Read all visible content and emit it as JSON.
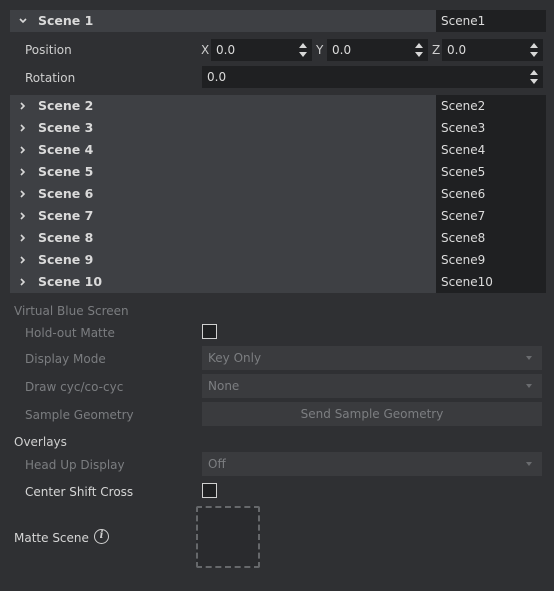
{
  "scene1": {
    "title": "Scene 1",
    "name_value": "Scene1",
    "position_label": "Position",
    "rotation_label": "Rotation",
    "axis_x": "X",
    "axis_y": "Y",
    "axis_z": "Z",
    "pos_x": "0.0",
    "pos_y": "0.0",
    "pos_z": "0.0",
    "rotation_value": "0.0"
  },
  "scenes": [
    {
      "title": "Scene 2",
      "name": "Scene2"
    },
    {
      "title": "Scene 3",
      "name": "Scene3"
    },
    {
      "title": "Scene 4",
      "name": "Scene4"
    },
    {
      "title": "Scene 5",
      "name": "Scene5"
    },
    {
      "title": "Scene 6",
      "name": "Scene6"
    },
    {
      "title": "Scene 7",
      "name": "Scene7"
    },
    {
      "title": "Scene 8",
      "name": "Scene8"
    },
    {
      "title": "Scene 9",
      "name": "Scene9"
    },
    {
      "title": "Scene 10",
      "name": "Scene10"
    }
  ],
  "virtual_blue_screen": {
    "heading": "Virtual Blue Screen",
    "holdout_label": "Hold-out Matte",
    "display_mode_label": "Display Mode",
    "display_mode_value": "Key Only",
    "draw_cyc_label": "Draw cyc/co-cyc",
    "draw_cyc_value": "None",
    "sample_geometry_label": "Sample Geometry",
    "sample_geometry_button": "Send Sample Geometry"
  },
  "overlays": {
    "heading": "Overlays",
    "hud_label": "Head Up Display",
    "hud_value": "Off",
    "center_shift_label": "Center Shift Cross"
  },
  "matte_scene": {
    "label": "Matte Scene",
    "info_glyph": "i"
  },
  "icons": {
    "expanded": "chevron-down-icon",
    "collapsed": "chevron-right-icon",
    "info": "info-icon"
  },
  "colors": {
    "panel_bg": "#2f3033",
    "scene_row_bg": "#3e4044",
    "field_bg": "#1f2022",
    "disabled_text": "#7b7d80"
  }
}
